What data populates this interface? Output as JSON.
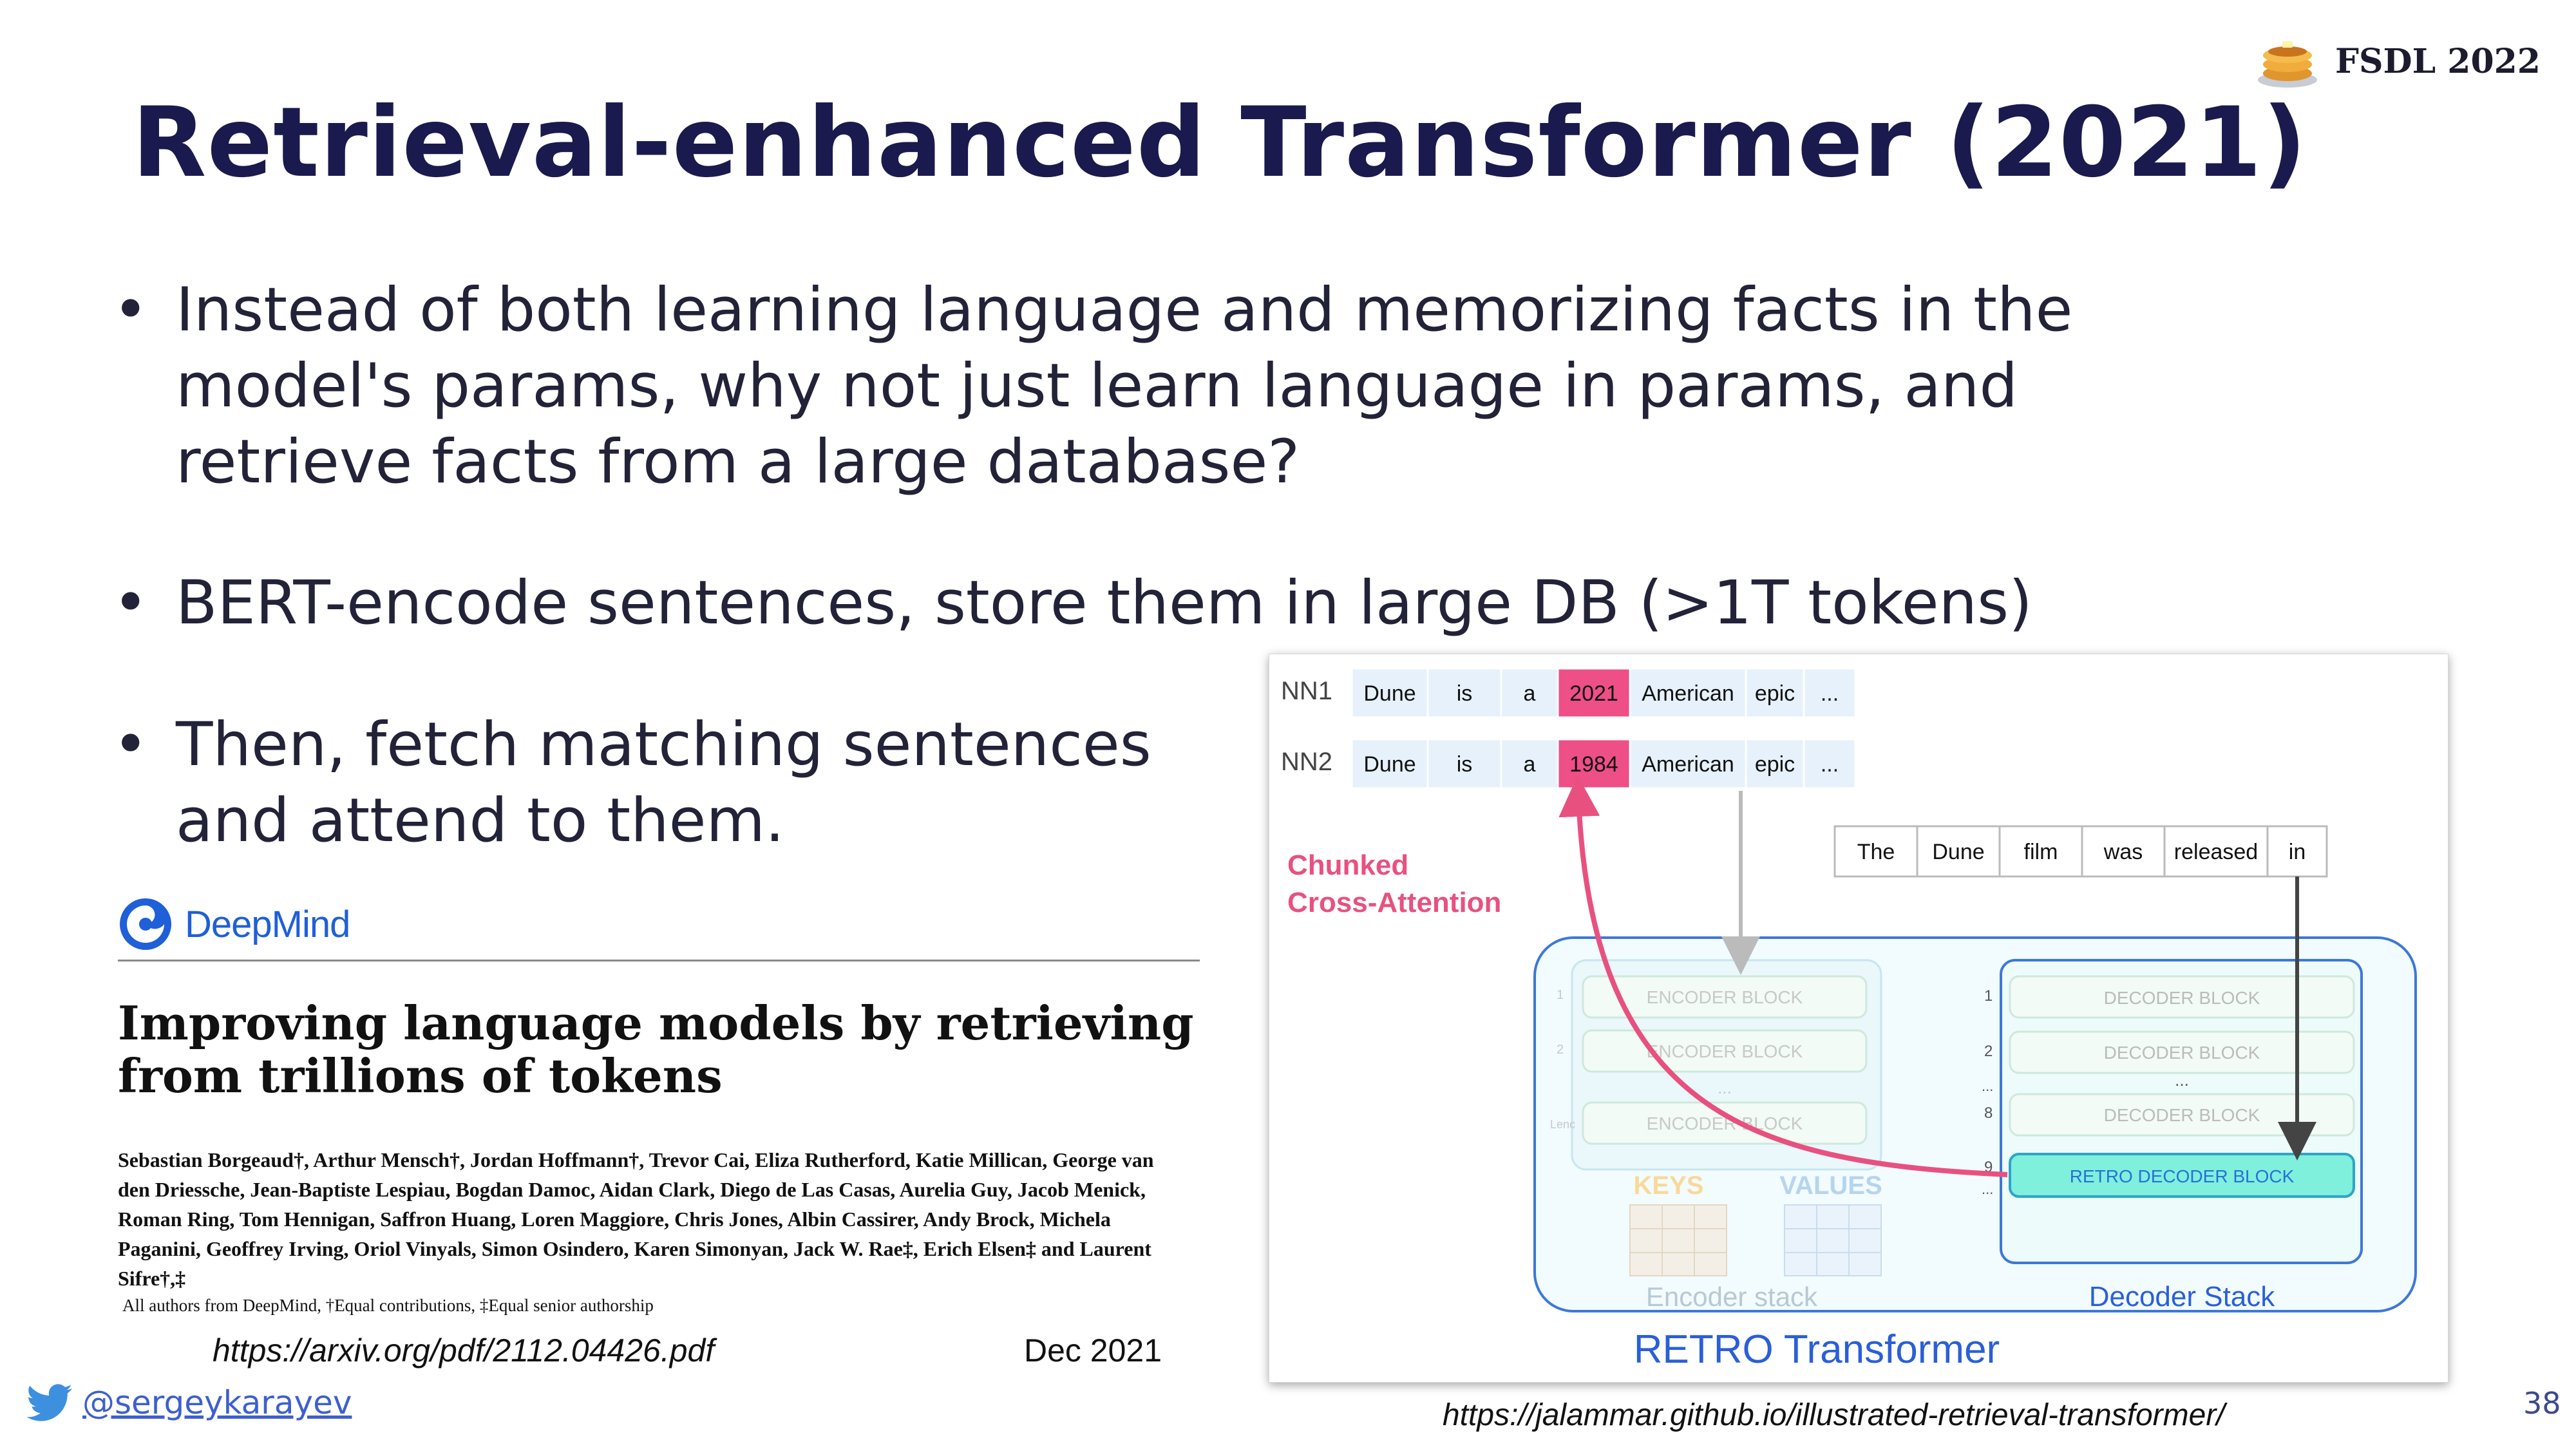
{
  "brand": {
    "text": "FSDL 2022",
    "icon": "pancake-stack-icon"
  },
  "title": "Retrieval-enhanced Transformer (2021)",
  "bullets": [
    {
      "marker": "•",
      "text": "Instead of both learning language and memorizing facts in the\nmodel's params, why not just learn language in params, and\nretrieve facts from a large database?"
    },
    {
      "marker": "•",
      "text": "BERT-encode sentences, store them in large DB (>1T tokens)"
    },
    {
      "marker": "•",
      "text": "Then, fetch matching sentences\nand attend to them."
    }
  ],
  "paper": {
    "org": "DeepMind",
    "title": "Improving language models by retrieving\nfrom trillions of tokens",
    "authors": "Sebastian Borgeaud†, Arthur Mensch†, Jordan Hoffmann†, Trevor Cai, Eliza Rutherford, Katie Millican, George van den Driessche, Jean-Baptiste Lespiau, Bogdan Damoc, Aidan Clark, Diego de Las Casas, Aurelia Guy, Jacob Menick, Roman Ring, Tom Hennigan, Saffron Huang, Loren Maggiore, Chris Jones, Albin Cassirer, Andy Brock, Michela Paganini, Geoffrey Irving, Oriol Vinyals, Simon Osindero, Karen Simonyan, Jack W. Rae‡, Erich Elsen‡ and Laurent Sifre†,‡",
    "affiliation": "All authors from DeepMind, †Equal contributions, ‡Equal senior authorship",
    "url": "https://arxiv.org/pdf/2112.04426.pdf",
    "date": "Dec 2021"
  },
  "figure": {
    "neighbors": [
      {
        "label": "NN1",
        "tokens": [
          "Dune",
          "is",
          "a",
          "2021",
          "American",
          "epic",
          "..."
        ],
        "highlight": 3
      },
      {
        "label": "NN2",
        "tokens": [
          "Dune",
          "is",
          "a",
          "1984",
          "American",
          "epic",
          "..."
        ],
        "highlight": 3
      }
    ],
    "input_tokens": [
      "The",
      "Dune",
      "film",
      "was",
      "released",
      "in"
    ],
    "cross_attention_label": [
      "Chunked",
      "Cross-Attention"
    ],
    "encoder_blocks": [
      "ENCODER BLOCK",
      "ENCODER BLOCK",
      "ENCODER BLOCK"
    ],
    "encoder_indices": [
      "1",
      "2",
      "Lenc"
    ],
    "decoder_blocks": [
      "DECODER BLOCK",
      "DECODER BLOCK",
      "DECODER BLOCK",
      "RETRO DECODER BLOCK"
    ],
    "decoder_indices": [
      "1",
      "2",
      "8",
      "9"
    ],
    "ellipsis": "...",
    "keys_label": "KEYS",
    "values_label": "VALUES",
    "encoder_stack_label": "Encoder stack",
    "decoder_stack_label": "Decoder Stack",
    "caption": "RETRO Transformer",
    "url": "https://jalammar.github.io/illustrated-retrieval-transformer/",
    "colors": {
      "highlight": "#ee4f86",
      "arrow": "#e8517f",
      "retro_block": "#7ef0dc",
      "stack_border": "#3c78d8"
    }
  },
  "footer": {
    "twitter_handle": "@sergeykarayev",
    "page_number": "38"
  }
}
